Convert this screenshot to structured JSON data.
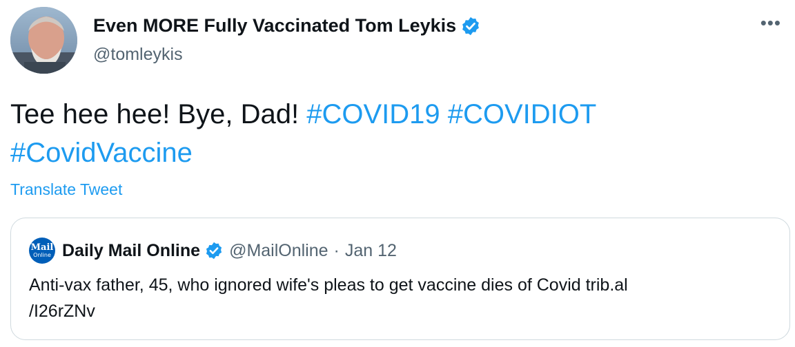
{
  "author": {
    "display_name": "Even MORE Fully Vaccinated Tom Leykis",
    "handle": "@tomleykis",
    "verified": true
  },
  "menu": {
    "more_label": "•••"
  },
  "tweet": {
    "text_prefix": "Tee hee hee! Bye, Dad!",
    "hashtags": [
      "#COVID19",
      "#COVIDIOT",
      "#CovidVaccine"
    ]
  },
  "translate_label": "Translate Tweet",
  "quote": {
    "logo_line1": "Mail",
    "logo_line2": "Online",
    "name": "Daily Mail Online",
    "verified": true,
    "handle": "@MailOnline",
    "separator": "·",
    "date": "Jan 12",
    "text_line1": "Anti-vax father, 45, who ignored wife's pleas to get vaccine dies of Covid trib.al",
    "text_line2": "/I26rZNv"
  },
  "colors": {
    "accent": "#1d9bf0",
    "secondary_text": "#536471",
    "border": "#cfd9de",
    "mail_blue": "#005eb8"
  },
  "icons": [
    "avatar",
    "verified-badge-icon",
    "more-icon",
    "mail-online-logo"
  ]
}
